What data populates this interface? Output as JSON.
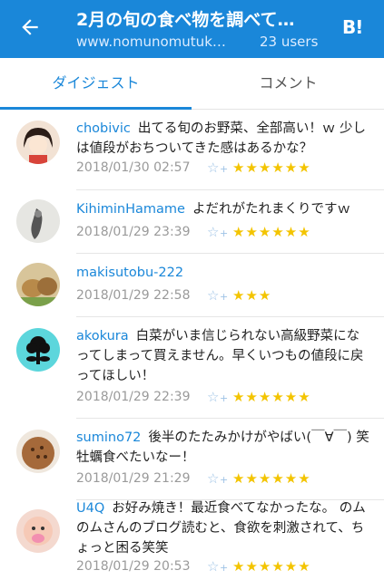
{
  "header": {
    "title": "2月の旬の食べ物を調べて…",
    "url": "www.nomunomutuk…",
    "users": "23 users",
    "hb_label": "B!"
  },
  "tabs": [
    {
      "label": "ダイジェスト",
      "active": true
    },
    {
      "label": "コメント",
      "active": false
    }
  ],
  "comments": [
    {
      "user": "chobivic",
      "text": "出てる旬のお野菜、全部高い！ｗ 少しは値段がおちついてきた感はあるかな？",
      "date": "2018/01/30 02:57",
      "stars": "★★★★★★"
    },
    {
      "user": "KihiminHamame",
      "text": "よだれがたれまくりですｗ",
      "date": "2018/01/29 23:39",
      "stars": "★★★★★★"
    },
    {
      "user": "makisutobu-222",
      "text": "",
      "date": "2018/01/29 22:58",
      "stars": "★★★"
    },
    {
      "user": "akokura",
      "text": "白菜がいま信じられない高級野菜になってしまって買えません。早くいつもの値段に戻ってほしい！",
      "date": "2018/01/29 22:39",
      "stars": "★★★★★★"
    },
    {
      "user": "sumino72",
      "text": "後半のたたみかけがやばい(￣∀￣) 笑 牡蠣食べたいなー！",
      "date": "2018/01/29 21:29",
      "stars": "★★★★★★"
    },
    {
      "user": "U4Q",
      "text": "お好み焼き！最近食べてなかったな。 のムのムさんのブログ読むと、食欲を刺激されて、ちょっと困る笑笑",
      "date": "2018/01/29 20:53",
      "stars": "★★★★★★"
    }
  ],
  "colors": {
    "accent": "#1a87d9",
    "star": "#f3c400"
  }
}
